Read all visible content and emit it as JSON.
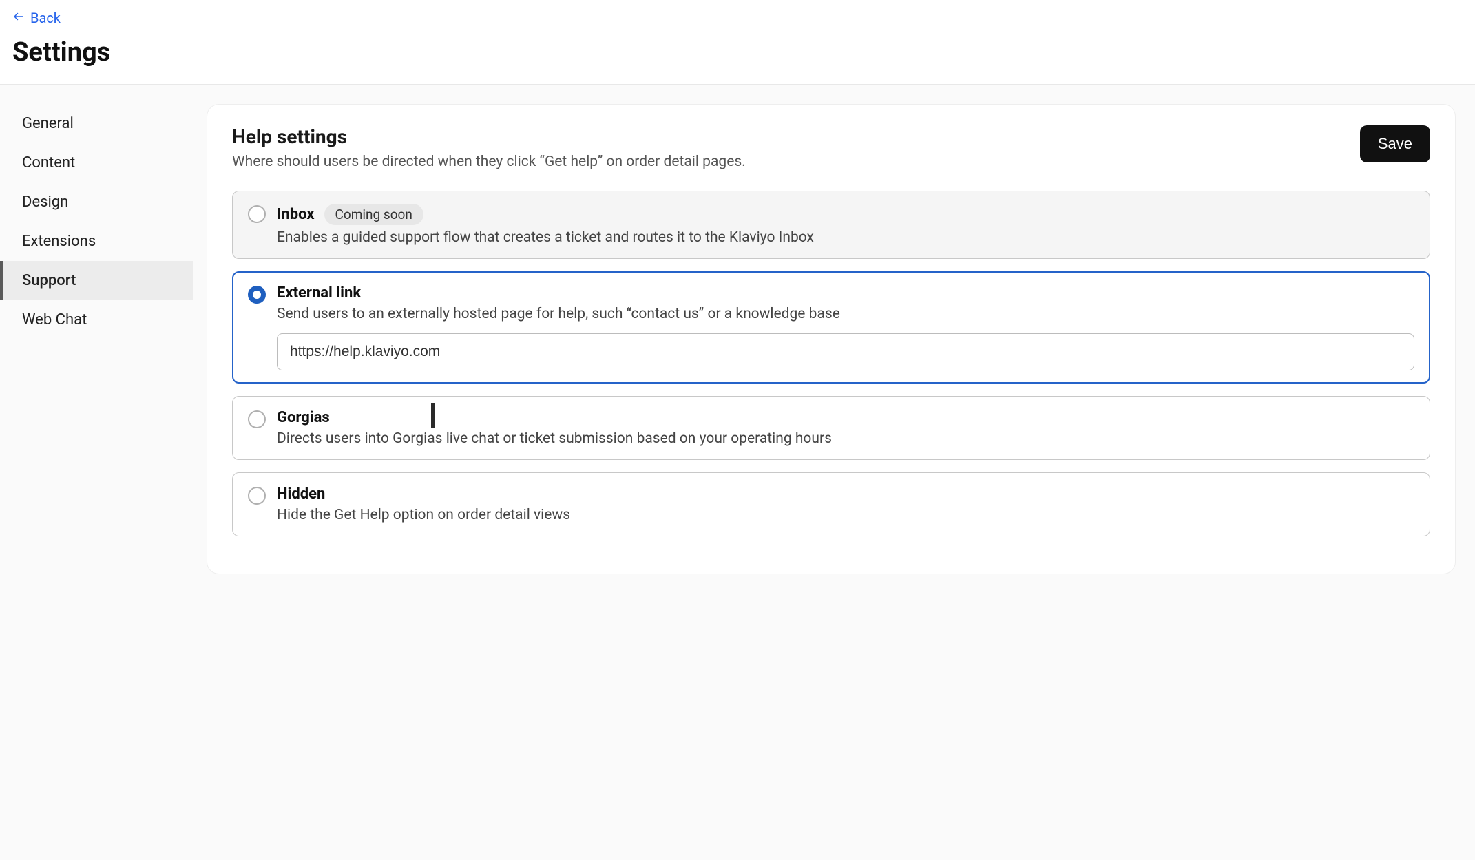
{
  "header": {
    "back_label": "Back",
    "page_title": "Settings"
  },
  "sidebar": {
    "items": [
      {
        "label": "General",
        "active": false
      },
      {
        "label": "Content",
        "active": false
      },
      {
        "label": "Design",
        "active": false
      },
      {
        "label": "Extensions",
        "active": false
      },
      {
        "label": "Support",
        "active": true
      },
      {
        "label": "Web Chat",
        "active": false
      }
    ]
  },
  "panel": {
    "title": "Help settings",
    "subtitle": "Where should users be directed when they click “Get help” on order detail pages.",
    "save_label": "Save",
    "options": [
      {
        "key": "inbox",
        "title": "Inbox",
        "badge": "Coming soon",
        "desc": "Enables a guided support flow that creates a ticket and routes it to the Klaviyo Inbox",
        "selected": false,
        "disabled": true
      },
      {
        "key": "external",
        "title": "External link",
        "desc": "Send users to an externally hosted page for help, such “contact us” or a knowledge base",
        "selected": true,
        "url_value": "https://help.klaviyo.com"
      },
      {
        "key": "gorgias",
        "title": "Gorgias",
        "desc": "Directs users into Gorgias live chat or ticket submission based on your operating hours",
        "selected": false
      },
      {
        "key": "hidden",
        "title": "Hidden",
        "desc": "Hide the Get Help option on order detail views",
        "selected": false
      }
    ]
  }
}
